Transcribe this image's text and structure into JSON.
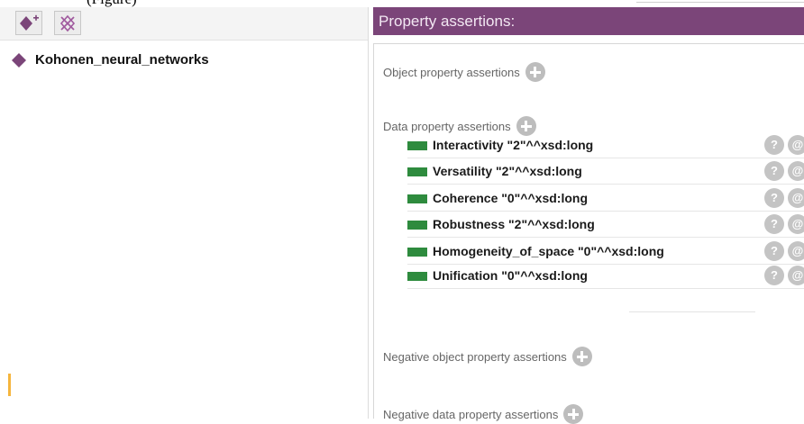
{
  "top_caption": "(Figure)",
  "left_pane": {
    "toolbar": {
      "add_individual_icon": "diamond-plus-icon",
      "delete_individual_icon": "diamond-cross-icon"
    },
    "tree": {
      "items": [
        {
          "label": "Kohonen_neural_networks",
          "icon": "diamond-icon"
        }
      ]
    }
  },
  "right_pane": {
    "header": "Property assertions:",
    "sections": {
      "object": "Object property assertions",
      "data": "Data property assertions",
      "neg_object": "Negative object property assertions",
      "neg_data": "Negative data property assertions"
    },
    "data_assertions": [
      {
        "text": "Interactivity  \"2\"^^xsd:long"
      },
      {
        "text": "Versatility  \"2\"^^xsd:long"
      },
      {
        "text": "Coherence  \"0\"^^xsd:long"
      },
      {
        "text": "Robustness   \"2\"^^xsd:long"
      },
      {
        "text": "Homogeneity_of_space \"0\"^^xsd:long"
      },
      {
        "text": "Unification  \"0\"^^xsd:long"
      }
    ],
    "row_buttons": {
      "help": "?",
      "annotate": "@"
    }
  },
  "colors": {
    "header_bg": "#7b4579",
    "diamond": "#7b4579",
    "data_bar": "#2e8b3e",
    "button_gray": "#c4c4c4"
  }
}
